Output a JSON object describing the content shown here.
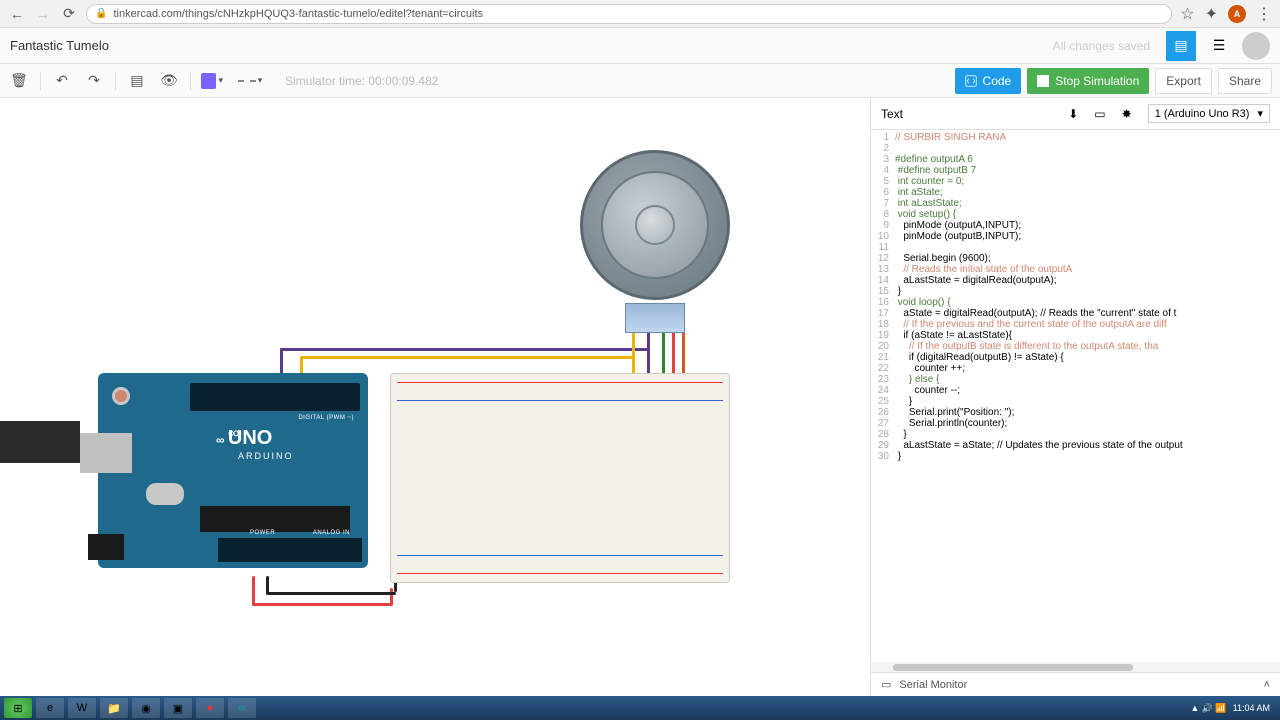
{
  "browser": {
    "url": "tinkercad.com/things/cNHzkpHQUQ3-fantastic-tumelo/editel?tenant=circuits"
  },
  "header": {
    "title": "Fantastic Tumelo",
    "saved": "All changes saved"
  },
  "toolbar": {
    "sim_time": "Simulator time: 00:00:09.482",
    "code": "Code",
    "stop": "Stop Simulation",
    "export": "Export",
    "share": "Share"
  },
  "code_panel": {
    "mode": "Text",
    "board": "1 (Arduino Uno R3)",
    "serial": "Serial Monitor",
    "lines": [
      {
        "n": 1,
        "t": "// SURBIR SINGH RANA",
        "cls": "c-comment"
      },
      {
        "n": 2,
        "t": ""
      },
      {
        "n": 3,
        "t": "#define outputA 6",
        "cls": "c-kw"
      },
      {
        "n": 4,
        "t": " #define outputB 7",
        "cls": "c-kw"
      },
      {
        "n": 5,
        "t": " int counter = 0;",
        "cls": "c-kw"
      },
      {
        "n": 6,
        "t": " int aState;",
        "cls": "c-kw"
      },
      {
        "n": 7,
        "t": " int aLastState;",
        "cls": "c-kw"
      },
      {
        "n": 8,
        "t": " void setup() {",
        "cls": "c-kw"
      },
      {
        "n": 9,
        "t": "   pinMode (outputA,INPUT);",
        "cls": ""
      },
      {
        "n": 10,
        "t": "   pinMode (outputB,INPUT);",
        "cls": ""
      },
      {
        "n": 11,
        "t": ""
      },
      {
        "n": 12,
        "t": "   Serial.begin (9600);",
        "cls": ""
      },
      {
        "n": 13,
        "t": "   // Reads the initial state of the outputA",
        "cls": "c-comment"
      },
      {
        "n": 14,
        "t": "   aLastState = digitalRead(outputA);",
        "cls": ""
      },
      {
        "n": 15,
        "t": " }",
        "cls": ""
      },
      {
        "n": 16,
        "t": " void loop() {",
        "cls": "c-kw"
      },
      {
        "n": 17,
        "t": "   aState = digitalRead(outputA); // Reads the \"current\" state of t",
        "cls": ""
      },
      {
        "n": 18,
        "t": "   // If the previous and the current state of the outputA are diff",
        "cls": "c-comment"
      },
      {
        "n": 19,
        "t": "   if (aState != aLastState){",
        "cls": ""
      },
      {
        "n": 20,
        "t": "     // If the outputB state is different to the outputA state, tha",
        "cls": "c-comment"
      },
      {
        "n": 21,
        "t": "     if (digitalRead(outputB) != aState) {",
        "cls": ""
      },
      {
        "n": 22,
        "t": "       counter ++;",
        "cls": ""
      },
      {
        "n": 23,
        "t": "     } else {",
        "cls": "c-kw"
      },
      {
        "n": 24,
        "t": "       counter --;",
        "cls": ""
      },
      {
        "n": 25,
        "t": "     }",
        "cls": ""
      },
      {
        "n": 26,
        "t": "     Serial.print(\"Position: \");",
        "cls": ""
      },
      {
        "n": 27,
        "t": "     Serial.println(counter);",
        "cls": ""
      },
      {
        "n": 28,
        "t": "   }",
        "cls": ""
      },
      {
        "n": 29,
        "t": "   aLastState = aState; // Updates the previous state of the output",
        "cls": ""
      },
      {
        "n": 30,
        "t": " }",
        "cls": ""
      }
    ]
  },
  "arduino": {
    "brand": "UNO",
    "sub": "ARDUINO",
    "digital": "DIGITAL (PWM ~)",
    "power": "POWER",
    "analog": "ANALOG IN"
  },
  "tray": {
    "time": "11:04 AM"
  }
}
